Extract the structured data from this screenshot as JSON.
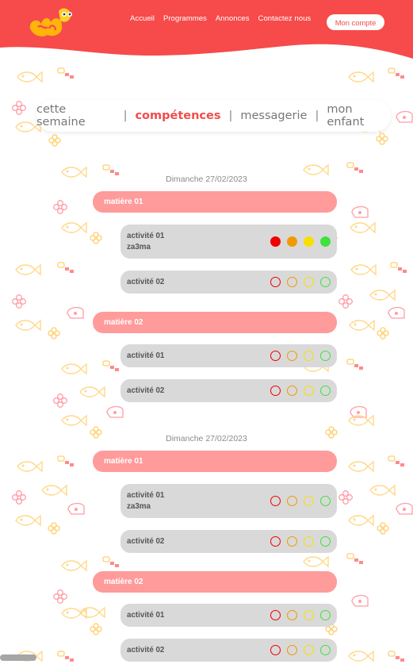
{
  "header": {
    "nav": [
      "Accueil",
      "Programmes",
      "Annonces",
      "Contactez nous"
    ],
    "account_button": "Mon compte",
    "logo": "logo-icon"
  },
  "colors": {
    "header_red": "#f74a4a",
    "accent": "#f04c4c",
    "subject_bar": "#ff9b9b",
    "activity_card": "#d9d9d9",
    "status_red": "#ee0000",
    "status_orange": "#f09a00",
    "status_yellow": "#f7e000",
    "status_green": "#3ee23e"
  },
  "tabs": {
    "items": [
      "cette semaine",
      "compétences",
      "messagerie",
      "mon enfant"
    ],
    "separator": "|",
    "active": "compétences"
  },
  "days": [
    {
      "date": "Dimanche 27/02/2023",
      "subjects": [
        {
          "label": "matière 01",
          "activities": [
            {
              "line1": "activité 01",
              "line2": "za3ma",
              "statuses": [
                "filled",
                "filled",
                "filled",
                "filled"
              ]
            },
            {
              "line1": "activité 02",
              "line2": "",
              "statuses": [
                "outline",
                "outline",
                "outline",
                "outline"
              ]
            }
          ]
        },
        {
          "label": "matière 02",
          "activities": [
            {
              "line1": "activité 01",
              "line2": "",
              "statuses": [
                "outline",
                "outline",
                "outline",
                "outline"
              ]
            },
            {
              "line1": "activité 02",
              "line2": "",
              "statuses": [
                "outline",
                "outline",
                "outline",
                "outline"
              ]
            }
          ]
        }
      ]
    },
    {
      "date": "Dimanche 27/02/2023",
      "subjects": [
        {
          "label": "matière 01",
          "activities": [
            {
              "line1": "activité 01",
              "line2": "za3ma",
              "statuses": [
                "outline",
                "outline",
                "outline",
                "outline"
              ]
            },
            {
              "line1": "activité 02",
              "line2": "",
              "statuses": [
                "outline",
                "outline",
                "outline",
                "outline"
              ]
            }
          ]
        },
        {
          "label": "matière 02",
          "activities": [
            {
              "line1": "activité 01",
              "line2": "",
              "statuses": [
                "outline",
                "outline",
                "outline",
                "outline"
              ]
            },
            {
              "line1": "activité 02",
              "line2": "",
              "statuses": [
                "outline",
                "outline",
                "outline",
                "outline"
              ]
            }
          ]
        }
      ]
    }
  ]
}
